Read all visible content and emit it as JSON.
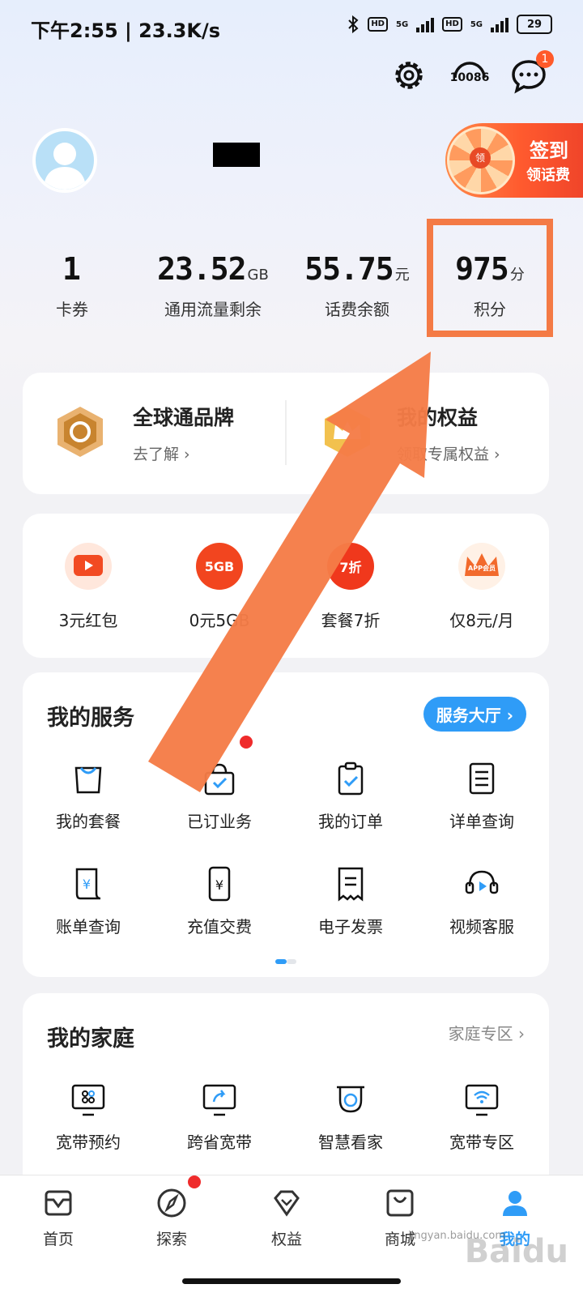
{
  "status_bar": {
    "time": "下午2:55 | 23.3K/s",
    "battery": "29",
    "hd": "HD",
    "net": "5G"
  },
  "header": {
    "customer_service_label": "10086",
    "message_badge": "1"
  },
  "signin": {
    "line1": "签到",
    "line2": "领话费",
    "wheel_center": "领"
  },
  "stats": [
    {
      "value": "1",
      "unit": "",
      "label": "卡券"
    },
    {
      "value": "23.52",
      "unit": "GB",
      "label": "通用流量剩余"
    },
    {
      "value": "55.75",
      "unit": "元",
      "label": "话费余额"
    },
    {
      "value": "975",
      "unit": "分",
      "label": "积分"
    }
  ],
  "brand": {
    "left": {
      "title": "全球通品牌",
      "sub": "去了解 ›"
    },
    "right": {
      "title": "我的权益",
      "sub": "领取专属权益 ›"
    }
  },
  "promos": [
    {
      "label": "3元红包",
      "icon_text": ""
    },
    {
      "label": "0元5GB",
      "icon_text": "5GB"
    },
    {
      "label": "套餐7折",
      "icon_text": "7折"
    },
    {
      "label": "仅8元/月",
      "icon_text": "APP会员"
    }
  ],
  "services": {
    "title": "我的服务",
    "hall_button": "服务大厅 ›",
    "items": [
      {
        "label": "我的套餐",
        "icon": "bag-icon"
      },
      {
        "label": "已订业务",
        "icon": "subscribed-bag-icon"
      },
      {
        "label": "我的订单",
        "icon": "clipboard-check-icon"
      },
      {
        "label": "详单查询",
        "icon": "list-doc-icon"
      },
      {
        "label": "账单查询",
        "icon": "bill-yuan-icon"
      },
      {
        "label": "充值交费",
        "icon": "phone-yuan-icon"
      },
      {
        "label": "电子发票",
        "icon": "receipt-icon"
      },
      {
        "label": "视频客服",
        "icon": "headset-video-icon"
      }
    ]
  },
  "family": {
    "title": "我的家庭",
    "more": "家庭专区 ›",
    "items": [
      {
        "label": "宽带预约",
        "icon": "tv-grid-icon"
      },
      {
        "label": "跨省宽带",
        "icon": "tv-share-icon"
      },
      {
        "label": "智慧看家",
        "icon": "camera-icon"
      },
      {
        "label": "宽带专区",
        "icon": "tv-wifi-icon"
      }
    ]
  },
  "nav": [
    {
      "label": "首页",
      "icon": "home-icon"
    },
    {
      "label": "探索",
      "icon": "compass-icon"
    },
    {
      "label": "权益",
      "icon": "diamond-icon"
    },
    {
      "label": "商城",
      "icon": "shop-bag-icon"
    },
    {
      "label": "我的",
      "icon": "user-icon"
    }
  ],
  "colors": {
    "accent": "#2f9cf7",
    "highlight": "#f47a45",
    "badge": "#ff5a2a"
  },
  "watermark": {
    "brand": "Baidu",
    "domain": "jingyan.baidu.com"
  }
}
